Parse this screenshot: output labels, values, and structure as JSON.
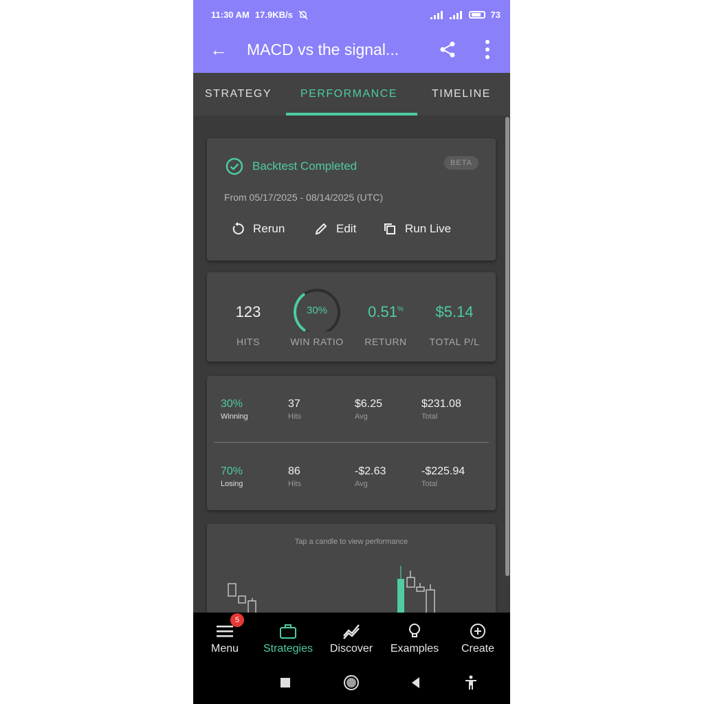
{
  "status_bar": {
    "time": "11:30 AM",
    "speed": "17.9KB/s",
    "battery": "73"
  },
  "app_bar": {
    "title": "MACD vs the signal..."
  },
  "tabs": [
    {
      "label": "STRATEGY",
      "active": false
    },
    {
      "label": "PERFORMANCE",
      "active": true
    },
    {
      "label": "TIMELINE",
      "active": false
    }
  ],
  "backtest": {
    "status": "Backtest Completed",
    "badge": "BETA",
    "range": "From 05/17/2025 - 08/14/2025 (UTC)",
    "actions": {
      "rerun": "Rerun",
      "edit": "Edit",
      "run_live": "Run Live"
    }
  },
  "summary": {
    "hits": {
      "value": "123",
      "label": "HITS"
    },
    "win_ratio": {
      "value": "30%",
      "label": "WIN RATIO",
      "fraction": 0.3
    },
    "return": {
      "value": "0.51",
      "unit": "%",
      "label": "RETURN"
    },
    "total_pl": {
      "value": "$5.14",
      "label": "TOTAL P/L"
    }
  },
  "breakdown": {
    "winning": {
      "pct": "30%",
      "pct_label": "Winning",
      "hits": "37",
      "hits_label": "Hits",
      "avg": "$6.25",
      "avg_label": "Avg",
      "total": "$231.08",
      "total_label": "Total"
    },
    "losing": {
      "pct": "70%",
      "pct_label": "Losing",
      "hits": "86",
      "hits_label": "Hits",
      "avg": "-$2.63",
      "avg_label": "Avg",
      "total": "-$225.94",
      "total_label": "Total"
    }
  },
  "candles_card": {
    "hint": "Tap a candle to view performance"
  },
  "bottom_nav": [
    {
      "label": "Menu",
      "icon": "menu-icon",
      "badge": "5",
      "active": false
    },
    {
      "label": "Strategies",
      "icon": "briefcase-icon",
      "active": true
    },
    {
      "label": "Discover",
      "icon": "trend-icon",
      "active": false
    },
    {
      "label": "Examples",
      "icon": "lightbulb-icon",
      "active": false
    },
    {
      "label": "Create",
      "icon": "plus-circle-icon",
      "active": false
    }
  ],
  "colors": {
    "accent": "#4fcca0",
    "header": "#8a80fa",
    "background": "#3a3a3a",
    "card": "#474747"
  }
}
